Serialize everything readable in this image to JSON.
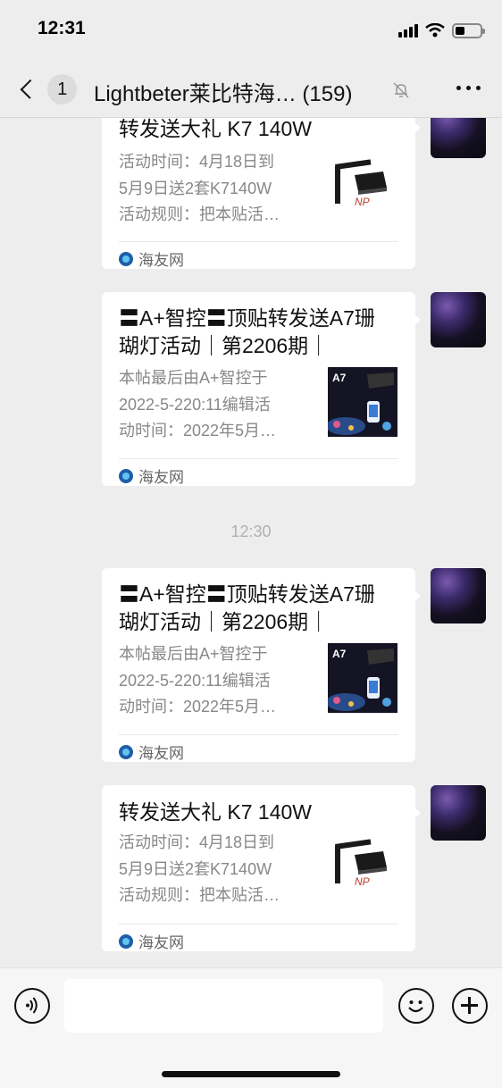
{
  "status_bar": {
    "time": "12:31"
  },
  "nav": {
    "back_badge": "1",
    "title": "Lightbeter莱比特海…",
    "member_count": "(159)"
  },
  "messages": [
    {
      "title": "转发送大礼 K7 140W",
      "desc": [
        "活动时间：4月18日到",
        "5月9日送2套K7140W",
        "活动规则：把本贴活…"
      ],
      "source": "海友网",
      "thumb": "k7-light-fixture"
    },
    {
      "title": "〓A+智控〓顶贴转发送A7珊 瑚灯活动｜第2206期｜",
      "desc": [
        "本帖最后由A+智控于",
        "2022-5-220:11编辑活",
        "动时间：2022年5月…"
      ],
      "source": "海友网",
      "thumb": "a7-coral-light"
    },
    {
      "title": "〓A+智控〓顶贴转发送A7珊 瑚灯活动｜第2206期｜",
      "desc": [
        "本帖最后由A+智控于",
        "2022-5-220:11编辑活",
        "动时间：2022年5月…"
      ],
      "source": "海友网",
      "thumb": "a7-coral-light"
    },
    {
      "title": "转发送大礼 K7 140W",
      "desc": [
        "活动时间：4月18日到",
        "5月9日送2套K7140W",
        "活动规则：把本贴活…"
      ],
      "source": "海友网",
      "thumb": "k7-light-fixture"
    }
  ],
  "time_divider": "12:30",
  "thumb_text": {
    "np_logo": "NP",
    "a7_label": "A7"
  },
  "colors": {
    "background": "#ededed",
    "card": "#ffffff",
    "secondary_text": "#888888",
    "source_icon": "#1f5ea8"
  },
  "input_bar": {
    "voice_icon": "voice-icon",
    "emoji_icon": "emoji-icon",
    "plus_icon": "plus-icon"
  }
}
